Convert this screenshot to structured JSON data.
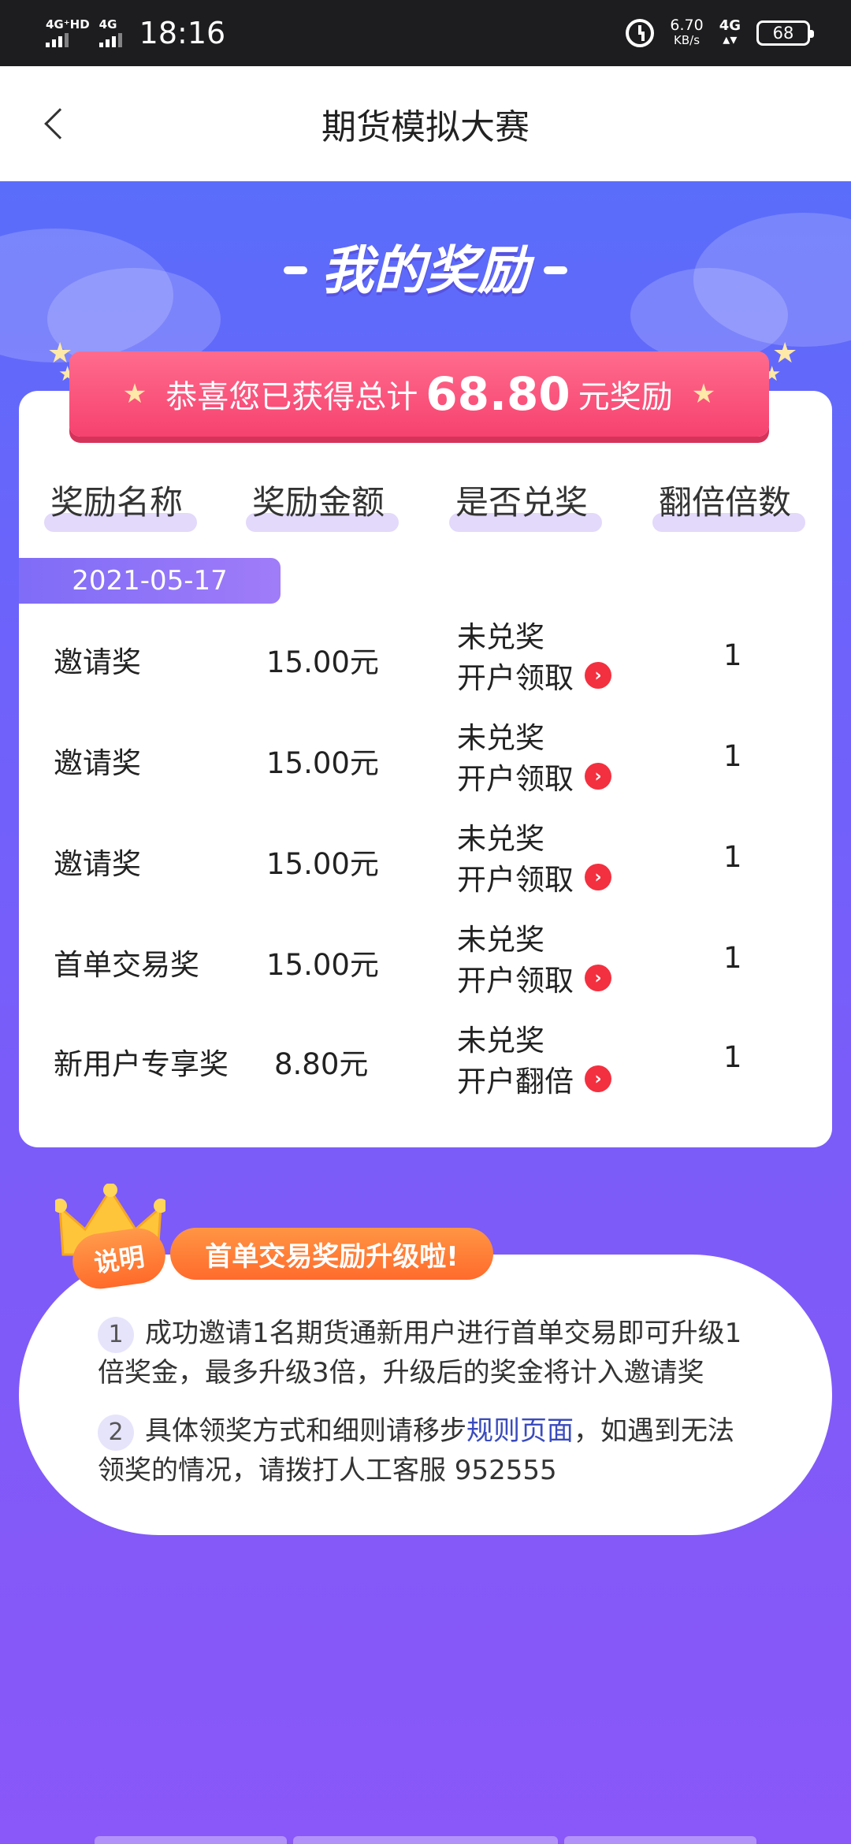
{
  "status_bar": {
    "sim1_label": "4G⁺HD",
    "sim2_label": "4G",
    "time": "18:16",
    "speed_value": "6.70",
    "speed_unit": "KB/s",
    "net_label": "4G",
    "battery": "68"
  },
  "nav": {
    "title": "期货模拟大赛"
  },
  "heading": {
    "title": "我的奖励"
  },
  "summary": {
    "lead": "恭喜您已获得总计",
    "amount": "68.80",
    "suffix": "元奖励"
  },
  "table": {
    "headers": [
      "奖励名称",
      "奖励金额",
      "是否兑奖",
      "翻倍倍数"
    ],
    "date": "2021-05-17",
    "rows": [
      {
        "name": "邀请奖",
        "amount": "15.00元",
        "status": "未兑奖",
        "action": "开户领取",
        "multiplier": "1"
      },
      {
        "name": "邀请奖",
        "amount": "15.00元",
        "status": "未兑奖",
        "action": "开户领取",
        "multiplier": "1"
      },
      {
        "name": "邀请奖",
        "amount": "15.00元",
        "status": "未兑奖",
        "action": "开户领取",
        "multiplier": "1"
      },
      {
        "name": "首单交易奖",
        "amount": "15.00元",
        "status": "未兑奖",
        "action": "开户领取",
        "multiplier": "1"
      },
      {
        "name": "新用户专享奖",
        "amount": "8.80元",
        "status": "未兑奖",
        "action": "开户翻倍",
        "multiplier": "1"
      }
    ]
  },
  "notes": {
    "badge": "说明",
    "headline": "首单交易奖励升级啦!",
    "item1_num": "1",
    "item1_line1": "成功邀请1名期货通新用户进行首单交易即可升级1",
    "item1_line2": "倍奖金，最多升级3倍，升级后的奖金将计入邀请奖",
    "item2_num": "2",
    "item2_pre": "具体领奖方式和细则请移步",
    "item2_link": "规则页面",
    "item2_post": "，如遇到无法",
    "item2_line2": "领奖的情况，请拨打人工客服 952555"
  },
  "colors": {
    "accent_purple": "#7a5cf9",
    "banner_pink": "#f6426f",
    "badge_red": "#f3303f",
    "pill_orange": "#ff7a35",
    "link_blue": "#3a4bbd"
  }
}
